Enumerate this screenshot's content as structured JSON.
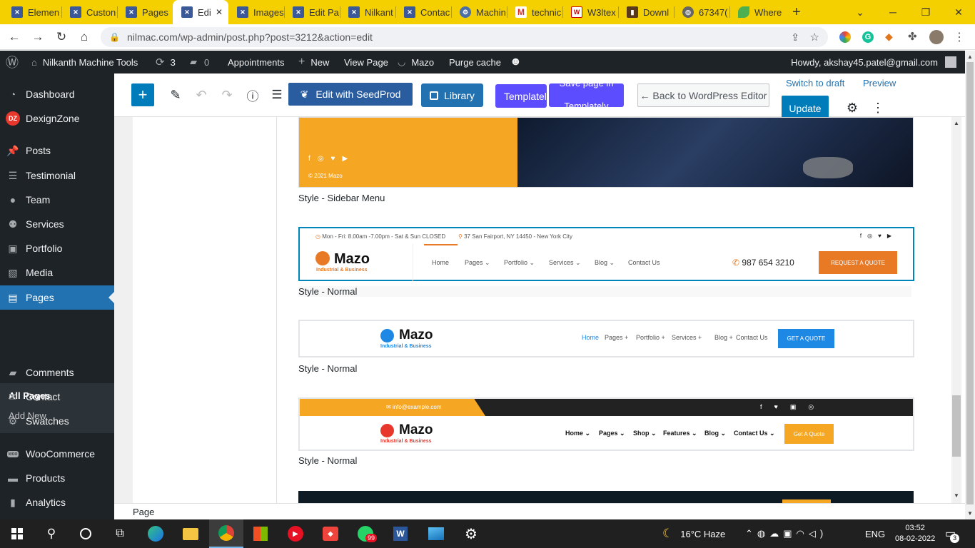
{
  "browser": {
    "tabs": [
      {
        "label": "Elemen",
        "icon": "nilmac-favicon"
      },
      {
        "label": "Custon",
        "icon": "nilmac-favicon"
      },
      {
        "label": "Pages",
        "icon": "nilmac-favicon"
      },
      {
        "label": "Edi",
        "icon": "nilmac-favicon",
        "active": true
      },
      {
        "label": "Images",
        "icon": "nilmac-favicon"
      },
      {
        "label": "Edit Pa",
        "icon": "nilmac-favicon"
      },
      {
        "label": "Nilkant",
        "icon": "nilmac-favicon"
      },
      {
        "label": "Contac",
        "icon": "nilmac-favicon"
      },
      {
        "label": "Machin",
        "icon": "gear-favicon"
      },
      {
        "label": "technic",
        "icon": "gmail-favicon"
      },
      {
        "label": "W3ltex",
        "icon": "w3-favicon"
      },
      {
        "label": "Downl",
        "icon": "download-favicon"
      },
      {
        "label": "67347(",
        "icon": "globe-favicon"
      },
      {
        "label": "Where",
        "icon": "leaf-favicon"
      }
    ],
    "close_glyph": "✕",
    "new_tab_glyph": "+",
    "url": "nilmac.com/wp-admin/post.php?post=3212&action=edit"
  },
  "admin_bar": {
    "site_name": "Nilkanth Machine Tools",
    "updates_count": "3",
    "comments_count": "0",
    "appointments": "Appointments",
    "new": "New",
    "view_page": "View Page",
    "mazo": "Mazo",
    "purge_cache": "Purge cache",
    "howdy": "Howdy, akshay45.patel@gmail.com"
  },
  "sidebar": {
    "items": [
      {
        "label": "Dashboard",
        "icon": "dashboard-icon"
      },
      {
        "label": "DexignZone",
        "icon": "dz-icon"
      },
      {
        "label": "Posts",
        "icon": "pin-icon"
      },
      {
        "label": "Testimonial",
        "icon": "testimonial-icon"
      },
      {
        "label": "Team",
        "icon": "person-icon"
      },
      {
        "label": "Services",
        "icon": "users-icon"
      },
      {
        "label": "Portfolio",
        "icon": "portfolio-icon"
      },
      {
        "label": "Media",
        "icon": "media-icon"
      },
      {
        "label": "Pages",
        "icon": "pages-icon",
        "current": true
      },
      {
        "label": "Comments",
        "icon": "comment-icon"
      },
      {
        "label": "Contact",
        "icon": "mail-icon"
      },
      {
        "label": "Swatches",
        "icon": "gear-icon"
      },
      {
        "label": "WooCommerce",
        "icon": "woo-icon"
      },
      {
        "label": "Products",
        "icon": "products-icon"
      },
      {
        "label": "Analytics",
        "icon": "analytics-icon"
      }
    ],
    "sub": {
      "all_pages": "All Pages",
      "add_new": "Add New"
    },
    "dz_badge": "DZ"
  },
  "toolbar": {
    "seedprod": "Edit with SeedProd",
    "library": "Library",
    "templately": "Templately",
    "save_templately": "Save page in Templately",
    "back": "← Back to WordPress Editor",
    "switch_draft": "Switch to draft",
    "preview": "Preview",
    "update": "Update"
  },
  "canvas": {
    "captions": [
      "Style - Sidebar Menu",
      "Style - Normal",
      "Style - Normal",
      "Style - Normal"
    ],
    "sidebar_copyright": "© 2021 Mazo",
    "h1": {
      "hours": "Mon - Fri: 8.00am -7.00pm - Sat & Sun CLOSED",
      "address": "37 San Fairport, NY 14450 - New York City",
      "brand": "Mazo",
      "tagline": "Industrial & Business",
      "nav": [
        "Home",
        "Pages ⌄",
        "Portfolio ⌄",
        "Services ⌄",
        "Blog ⌄",
        "Contact Us"
      ],
      "phone": "987 654 3210",
      "cta": "REQUEST A QUOTE"
    },
    "h2": {
      "brand": "Mazo",
      "tagline": "Industrial & Business",
      "nav": [
        "Home",
        "Pages +",
        "Portfolio +",
        "Services +",
        "Blog +",
        "Contact Us"
      ],
      "cta": "GET A QUOTE"
    },
    "h3": {
      "email": "info@example.com",
      "brand": "Mazo",
      "tagline": "Industrial & Business",
      "nav": [
        "Home ⌄",
        "Pages ⌄",
        "Shop ⌄",
        "Features ⌄",
        "Blog ⌄",
        "Contact Us ⌄"
      ],
      "cta": "Get A Quote"
    }
  },
  "status": {
    "breadcrumb": "Page"
  },
  "taskbar": {
    "weather": "16°C  Haze",
    "lang": "ENG",
    "time": "03:52",
    "date": "08-02-2022",
    "whatsapp_badge": "99",
    "notif_count": "3"
  },
  "colors": {
    "wp_blue": "#2271b1",
    "admin_dark": "#1d2327",
    "chrome_yellow": "#f5d000",
    "mazo_orange": "#f5a623",
    "mazo_red": "#e8372c",
    "gutenberg_blue": "#007cba"
  }
}
